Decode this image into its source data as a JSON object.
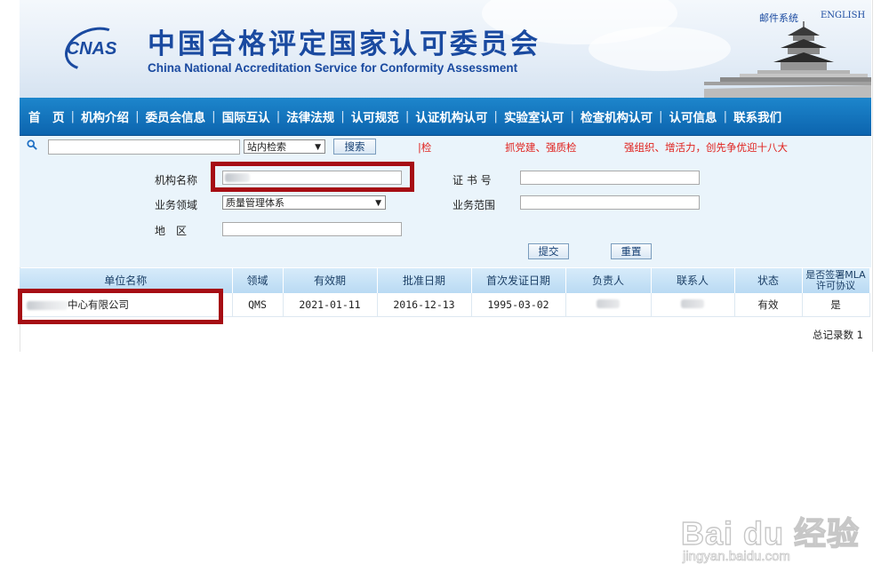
{
  "header": {
    "logo_text": "CNAS",
    "title_cn": "中国合格评定国家认可委员会",
    "title_en": "China National Accreditation Service for Conformity Assessment",
    "mail_link": "邮件系统",
    "english_link": "ENGLISH"
  },
  "nav": {
    "items": [
      "首　页",
      "机构介绍",
      "委员会信息",
      "国际互认",
      "法律法规",
      "认可规范",
      "认证机构认可",
      "实验室认可",
      "检查机构认可",
      "认可信息",
      "联系我们"
    ]
  },
  "search": {
    "input_value": "",
    "scope_select": "站内检索",
    "search_button": "搜索",
    "marquee": [
      "|检",
      "抓党建、强质检",
      "强组织、增活力，创先争优迎十八大"
    ]
  },
  "form": {
    "org_name_label": "机构名称",
    "cert_no_label": "证 书 号",
    "business_field_label": "业务领域",
    "business_field_value": "质量管理体系",
    "business_scope_label": "业务范围",
    "region_label": "地　区",
    "submit_button": "提交",
    "reset_button": "重置"
  },
  "table": {
    "headers": [
      "单位名称",
      "领域",
      "有效期",
      "批准日期",
      "首次发证日期",
      "负责人",
      "联系人",
      "状态",
      "是否签署MLA许可协议"
    ],
    "rows": [
      {
        "name_suffix": "中心有限公司",
        "field": "QMS",
        "valid_until": "2021-01-11",
        "approval_date": "2016-12-13",
        "first_issue_date": "1995-03-02",
        "responsible": "",
        "contact": "",
        "status": "有效",
        "mla": "是"
      }
    ],
    "total_label": "总记录数 1"
  },
  "watermark": {
    "main": "Bai du 经验",
    "sub": "jingyan.baidu.com"
  },
  "colors": {
    "nav_blue": "#0c64ae",
    "title_blue": "#1a4aa0",
    "highlight_red": "#a60d14",
    "marquee_red": "#e0201c"
  }
}
